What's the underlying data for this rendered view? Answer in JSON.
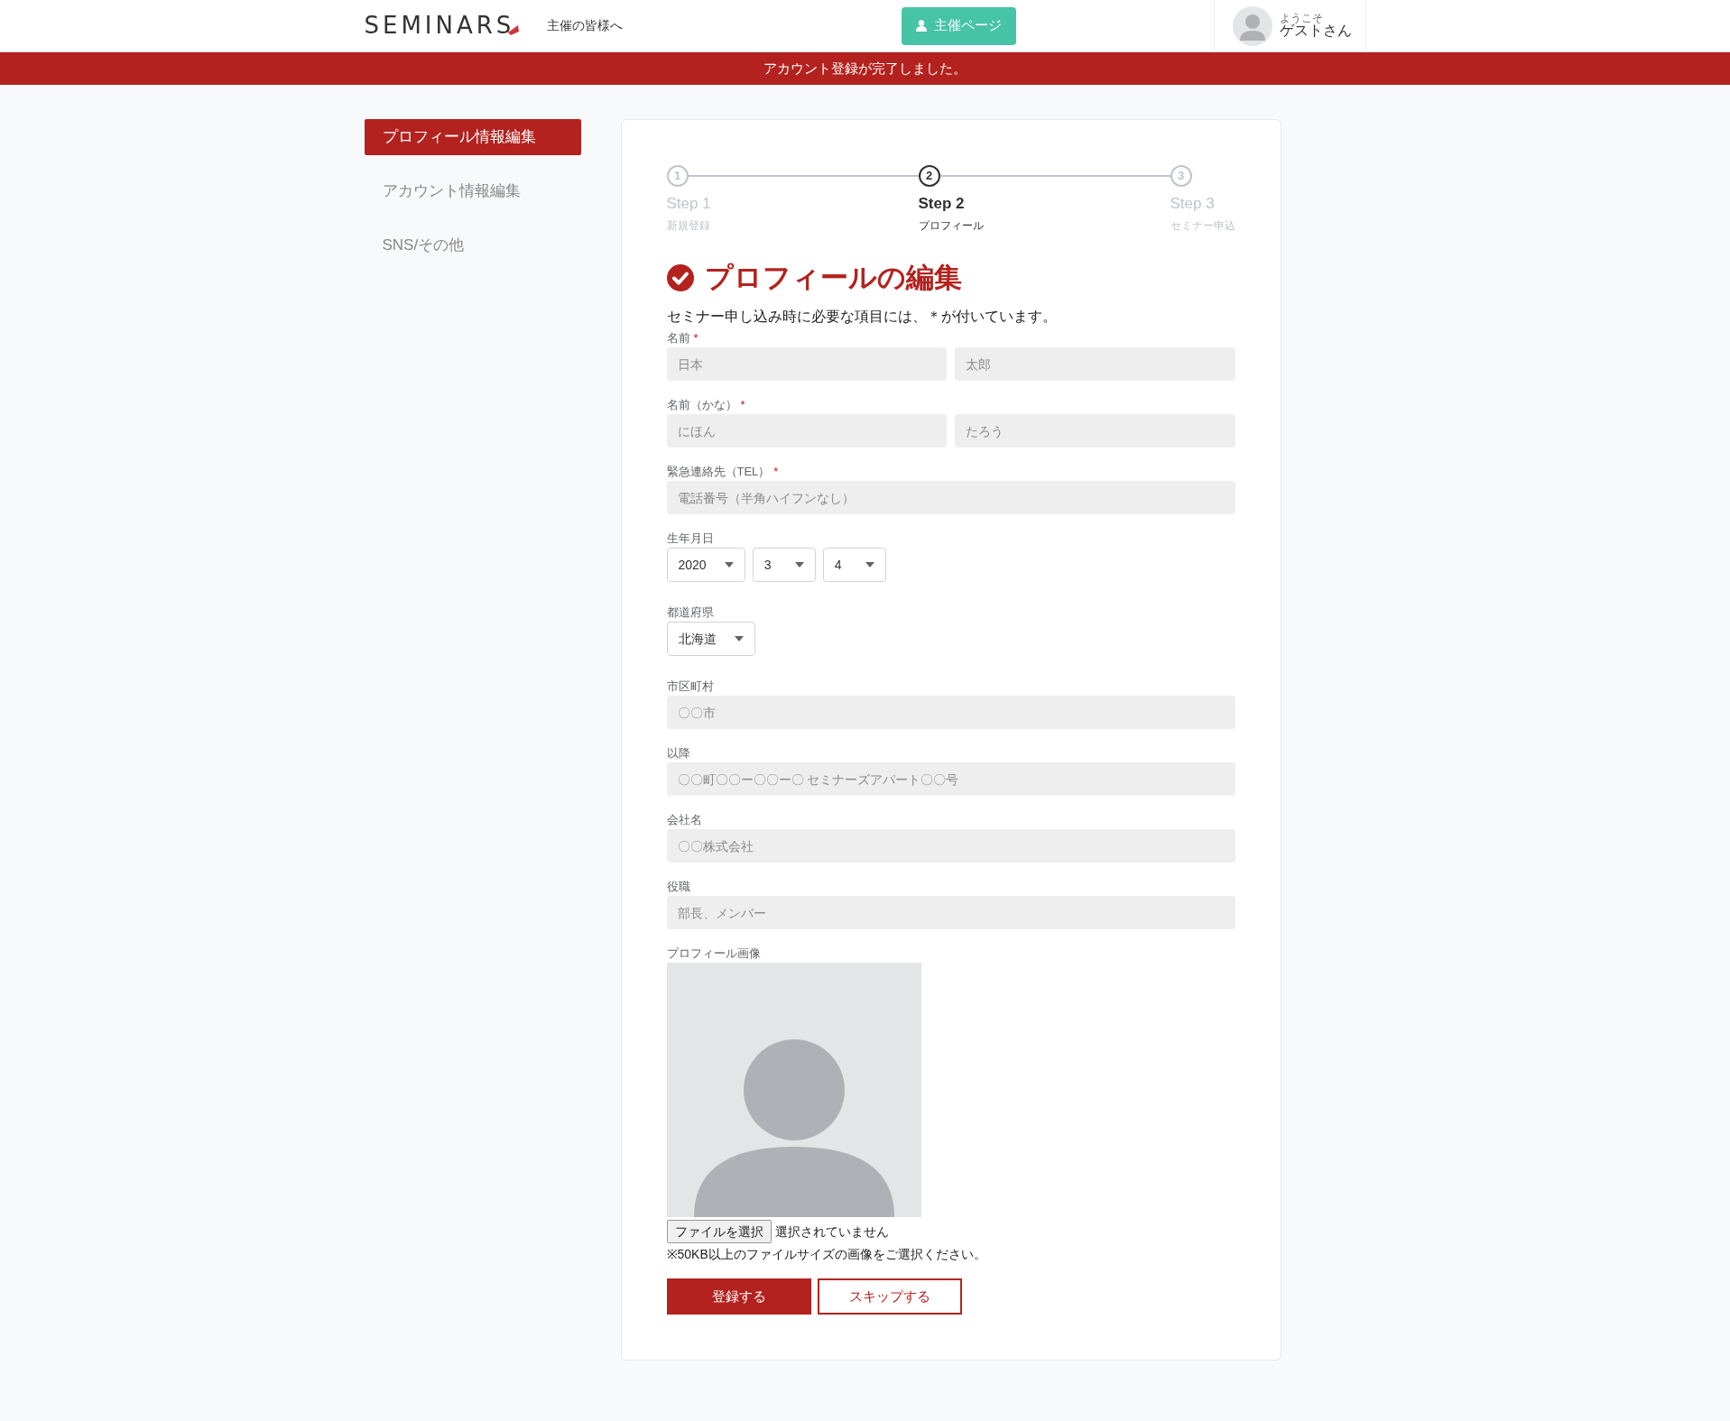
{
  "header": {
    "logo": "SEMINARS",
    "organizer_link": "主催の皆様へ",
    "organizer_button": "主催ページ",
    "welcome": "ようこそ",
    "user_name": "ゲストさん"
  },
  "banner": "アカウント登録が完了しました。",
  "sidebar": {
    "items": [
      {
        "label": "プロフィール情報編集",
        "selected": true
      },
      {
        "label": "アカウント情報編集",
        "selected": false
      },
      {
        "label": "SNS/その他",
        "selected": false
      }
    ]
  },
  "steps": [
    {
      "number": "1",
      "title": "Step 1",
      "subtitle": "新規登録",
      "selected": false
    },
    {
      "number": "2",
      "title": "Step 2",
      "subtitle": "プロフィール",
      "selected": true
    },
    {
      "number": "3",
      "title": "Step 3",
      "subtitle": "セミナー申込",
      "selected": false
    }
  ],
  "heading": "プロフィールの編集",
  "note": "セミナー申し込み時に必要な項目には、＊が付いています。",
  "fields": [
    {
      "kind": "text",
      "label": "名前",
      "mark": "*",
      "inputs": [
        {
          "placeholder": "日本"
        },
        {
          "placeholder": "太郎"
        }
      ]
    },
    {
      "kind": "text",
      "label": "名前（かな）",
      "mark": "*",
      "inputs": [
        {
          "placeholder": "にほん"
        },
        {
          "placeholder": "たろう"
        }
      ]
    },
    {
      "kind": "text",
      "label": "緊急連絡先（TEL）",
      "mark": "*",
      "inputs": [
        {
          "placeholder": "電話番号（半角ハイフンなし）"
        }
      ]
    },
    {
      "kind": "select",
      "label": "生年月日",
      "selects": [
        {
          "value": "2020"
        },
        {
          "value": "3"
        },
        {
          "value": "4"
        }
      ]
    },
    {
      "kind": "select",
      "label": "都道府県",
      "selects": [
        {
          "value": "北海道"
        }
      ]
    },
    {
      "kind": "text",
      "label": "市区町村",
      "inputs": [
        {
          "placeholder": "〇〇市"
        }
      ]
    },
    {
      "kind": "text",
      "label": "以降",
      "inputs": [
        {
          "placeholder": "〇〇町〇〇ー〇〇ー〇 セミナーズアパート〇〇号"
        }
      ]
    },
    {
      "kind": "text",
      "label": "会社名",
      "inputs": [
        {
          "placeholder": "〇〇株式会社"
        }
      ]
    },
    {
      "kind": "text",
      "label": "役職",
      "inputs": [
        {
          "placeholder": "部長、メンバー"
        }
      ]
    },
    {
      "kind": "image",
      "label": "プロフィール画像",
      "file_button": "ファイルを選択",
      "file_status": "選択されていません",
      "hint": "※50KB以上のファイルサイズの画像をご選択ください。"
    }
  ],
  "buttons": [
    {
      "label": "登録する",
      "kind": "primary"
    },
    {
      "label": "スキップする",
      "kind": "outline"
    }
  ]
}
